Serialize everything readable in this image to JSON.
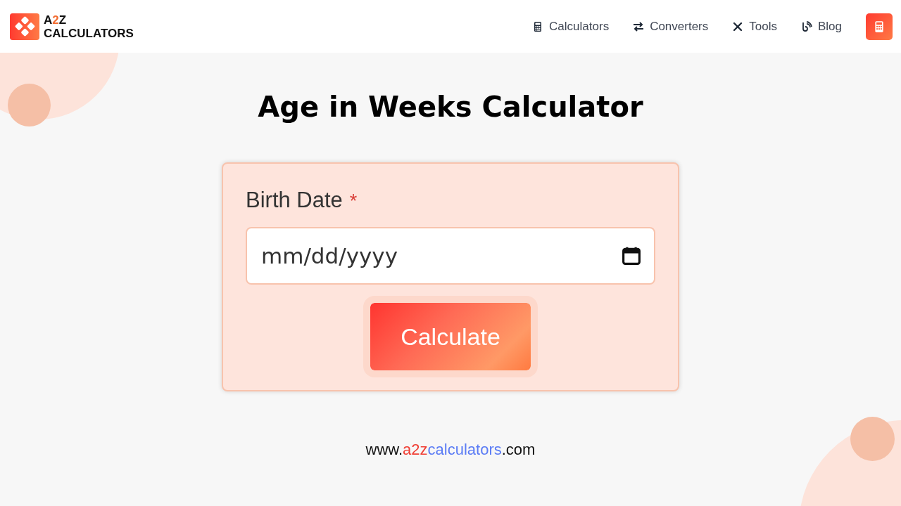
{
  "header": {
    "logo_top": [
      {
        "text": "A",
        "color": "#111111"
      },
      {
        "text": "2",
        "color": "#f26b2f"
      },
      {
        "text": "Z",
        "color": "#111111"
      }
    ],
    "logo_bottom": "CALCULATORS",
    "nav": [
      {
        "label": "Calculators",
        "kind": "calculator"
      },
      {
        "label": "Converters",
        "kind": "arrows"
      },
      {
        "label": "Tools",
        "kind": "tools"
      },
      {
        "label": "Blog",
        "kind": "blog"
      }
    ]
  },
  "title": "Age in Weeks Calculator",
  "form": {
    "label": "Birth Date",
    "required_mark": "*",
    "placeholder": "mm/dd/yyyy",
    "button": "Calculate"
  },
  "footer_url": [
    {
      "text": "www.",
      "color": "#111111"
    },
    {
      "text": "a2z",
      "color": "#f03e34"
    },
    {
      "text": "calculators",
      "color": "#5b7cf5"
    },
    {
      "text": ".com",
      "color": "#111111"
    }
  ]
}
